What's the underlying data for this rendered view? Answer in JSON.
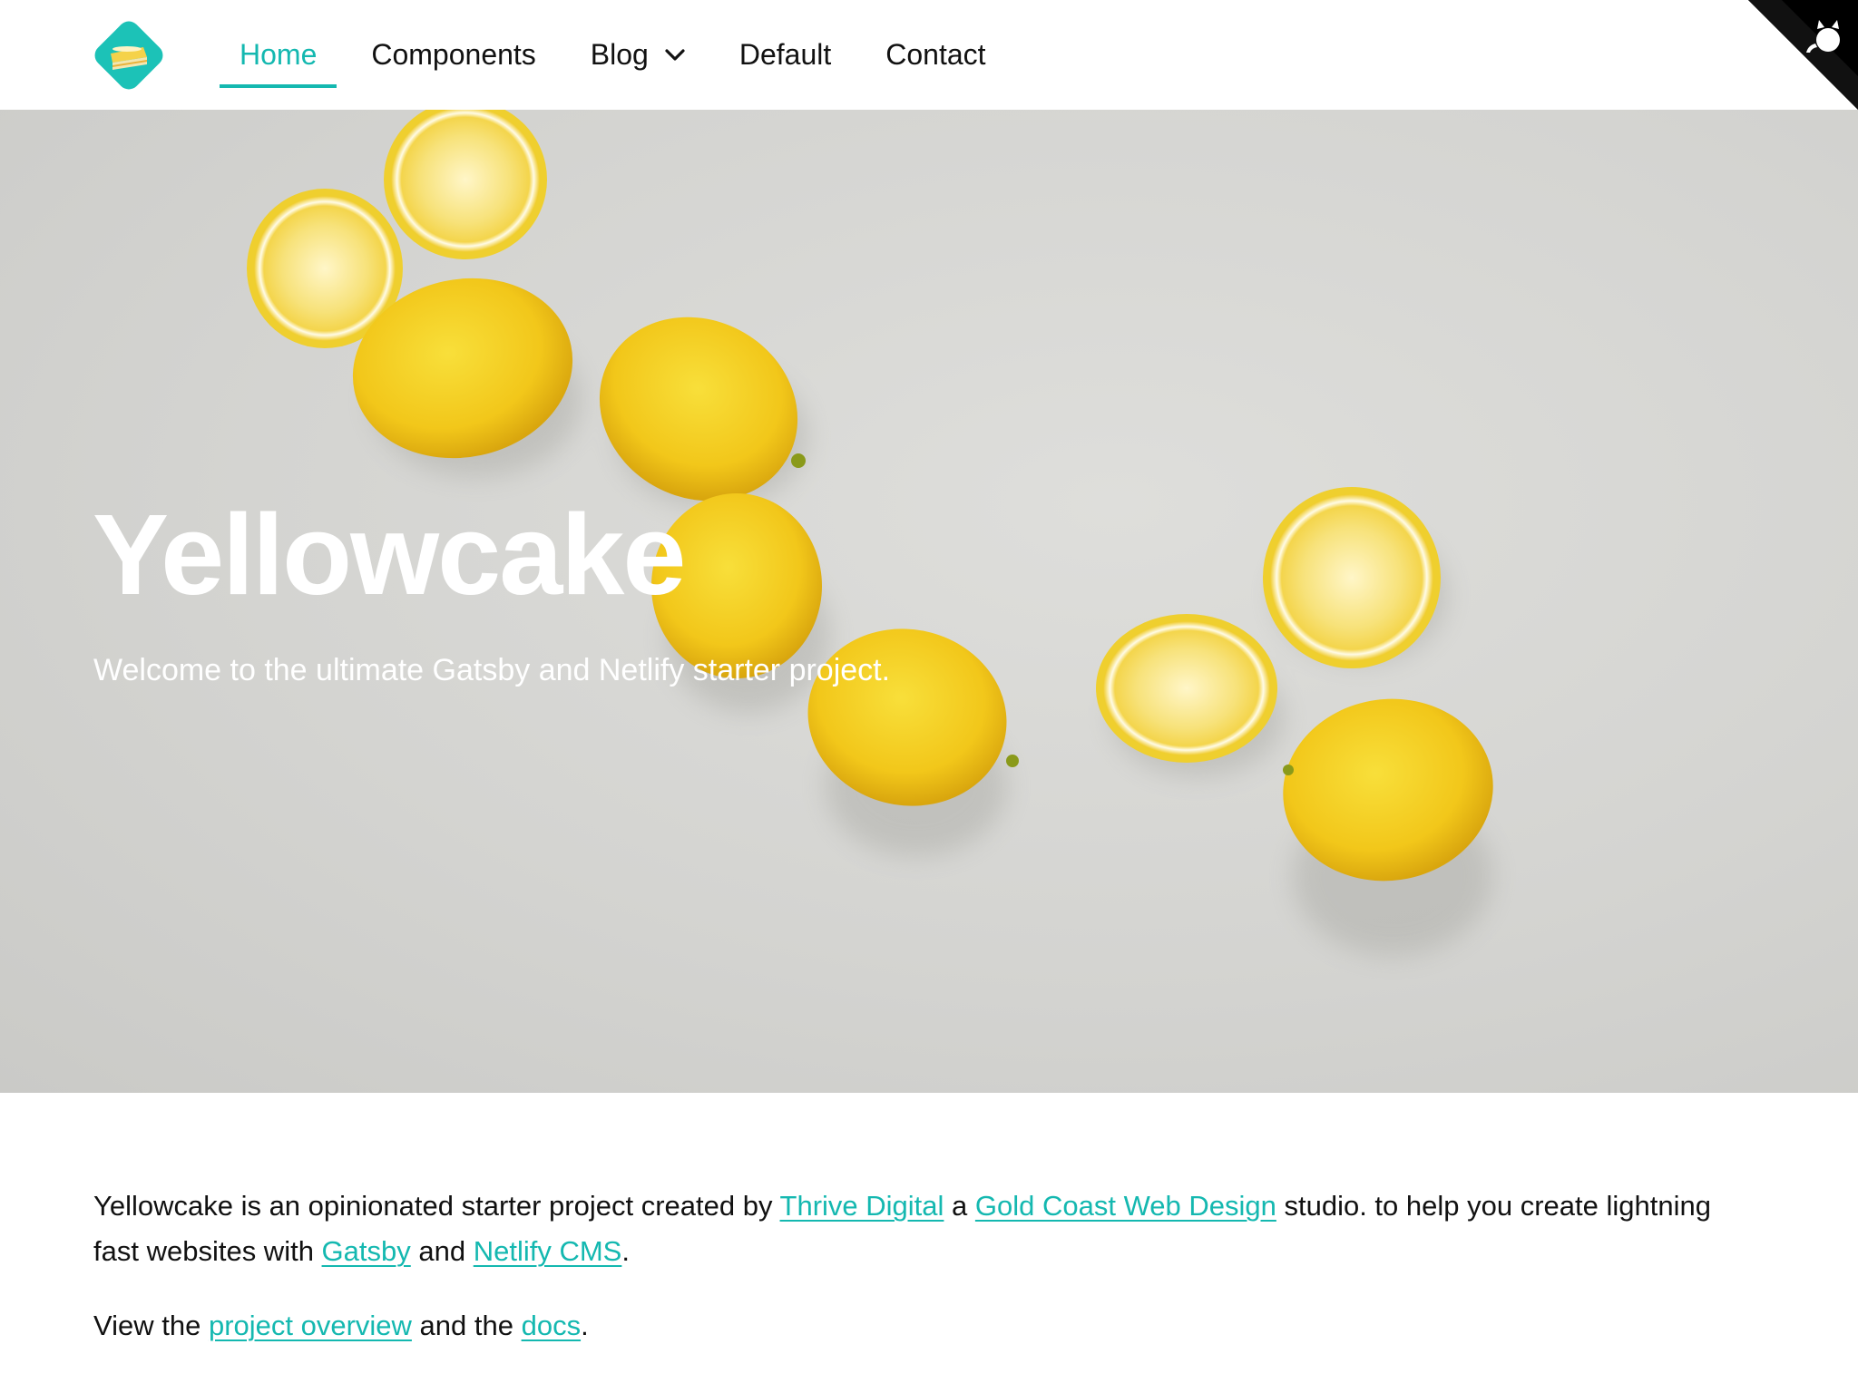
{
  "brand": {
    "accent_color": "#14b8b0",
    "logo_icon": "cake-slice-icon"
  },
  "nav": {
    "items": [
      {
        "label": "Home",
        "active": true
      },
      {
        "label": "Components",
        "active": false
      },
      {
        "label": "Blog",
        "active": false,
        "has_dropdown": true
      },
      {
        "label": "Default",
        "active": false
      },
      {
        "label": "Contact",
        "active": false
      }
    ]
  },
  "github_corner": {
    "icon": "github-octocat-icon"
  },
  "hero": {
    "title": "Yellowcake",
    "subtitle": "Welcome to the ultimate Gatsby and Netlify starter project.",
    "background_image": "lemons-photo"
  },
  "content": {
    "p1_intro": "Yellowcake is an opinionated starter project created by ",
    "p1_link1": "Thrive Digital",
    "p1_mid1": " a ",
    "p1_link2": "Gold Coast Web Design",
    "p1_mid2": " studio. to help you create lightning fast websites with ",
    "p1_link3": "Gatsby",
    "p1_mid3": " and ",
    "p1_link4": "Netlify CMS",
    "p1_end": ".",
    "p2_intro": "View the ",
    "p2_link1": "project overview",
    "p2_mid": " and the ",
    "p2_link2": "docs",
    "p2_end": "."
  }
}
